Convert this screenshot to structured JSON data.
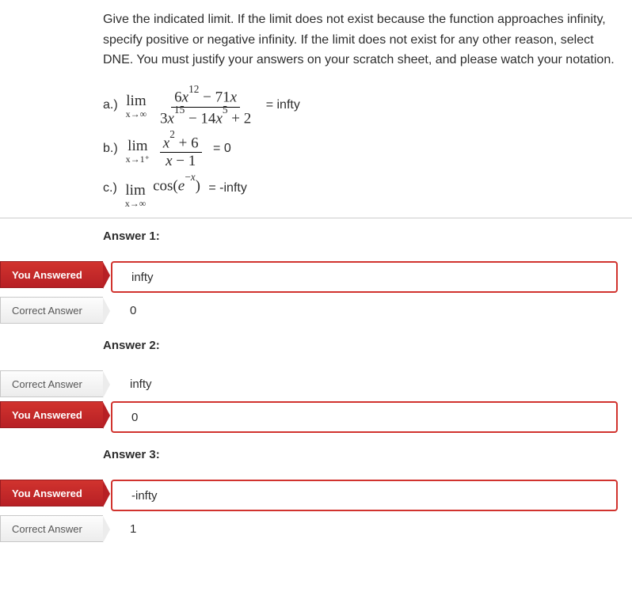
{
  "question": {
    "prompt": "Give the indicated limit.  If the limit does not exist because the function approaches infinity, specify positive or negative infinity.  If the limit does not exist for any other reason, select DNE. You must justify your answers on your scratch sheet, and please watch your notation.",
    "parts": {
      "a": {
        "label": "a.)",
        "lim_under": "x→∞",
        "num": "6x¹² − 71x",
        "den": "3x¹⁵ − 14x⁵ + 2",
        "given": "infty"
      },
      "b": {
        "label": "b.)",
        "lim_under": "x→1⁺",
        "num": "x² + 6",
        "den": "x − 1",
        "given": "0"
      },
      "c": {
        "label": "c.)",
        "lim_under": "x→∞",
        "body": "cos(e⁻ˣ)",
        "given": "-infty"
      }
    }
  },
  "labels": {
    "you_answered": "You Answered",
    "correct_answer": "Correct Answer"
  },
  "answers": [
    {
      "heading": "Answer 1:",
      "your": "infty",
      "correct": "0"
    },
    {
      "heading": "Answer 2:",
      "correct": "infty",
      "your": "0"
    },
    {
      "heading": "Answer 3:",
      "your": "-infty",
      "correct": "1"
    }
  ]
}
